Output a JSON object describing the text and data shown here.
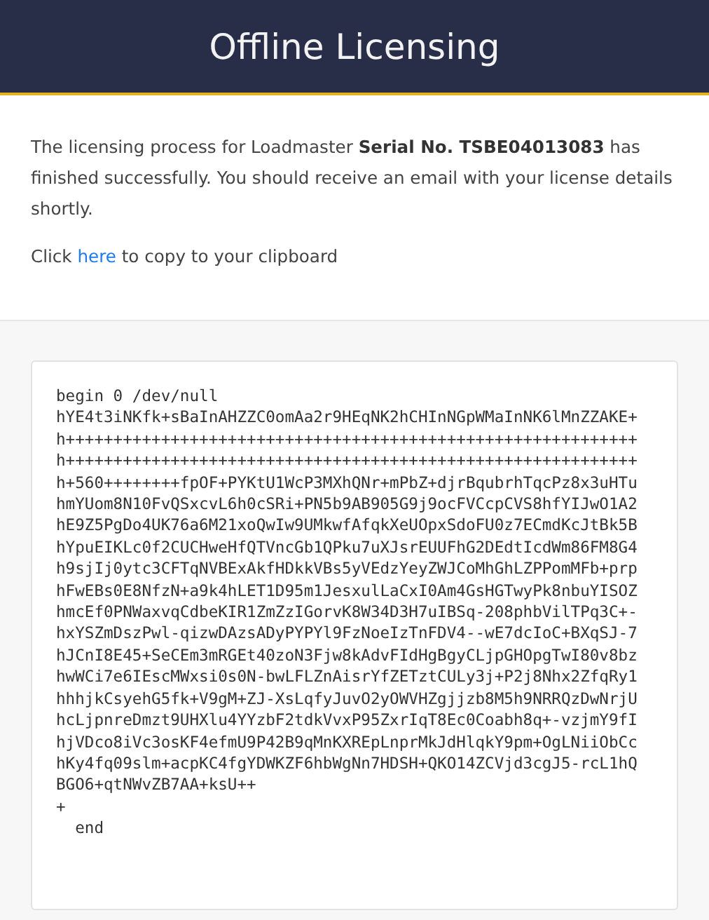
{
  "header": {
    "title": "Offline Licensing"
  },
  "message": "The licensing process for Loadmaster **Serial No. TSBE04013083** has finished successfully. You should receive an email with your license details shortly.",
  "copy_hint": {
    "before": "Click ",
    "link": "here",
    "after": " to copy to your clipboard"
  },
  "license_block": {
    "lines": [
      "begin 0 /dev/null",
      "hYE4t3iNKfk+sBaInAHZZC0omAa2r9HEqNK2hCHInNGpWMaInNK6lMnZZAKE+",
      "h++++++++++++++++++++++++++++++++++++++++++++++++++++++++++++",
      "h++++++++++++++++++++++++++++++++++++++++++++++++++++++++++++",
      "h+560++++++++fpOF+PYKtU1WcP3MXhQNr+mPbZ+djrBqubrhTqcPz8x3uHTu",
      "hmYUom8N10FvQSxcvL6h0cSRi+PN5b9AB905G9j9ocFVCcpCVS8hfYIJwO1A2",
      "hE9Z5PgDo4UK76a6M21xoQwIw9UMkwfAfqkXeUOpxSdoFU0z7ECmdKcJtBk5B",
      "hYpuEIKLc0f2CUCHweHfQTVncGb1QPku7uXJsrEUUFhG2DEdtIcdWm86FM8G4",
      "h9sjIj0ytc3CFTqNVBExAkfHDkkVBs5yVEdzYeyZWJCoMhGhLZPPomMFb+prp",
      "hFwEBs0E8NfzN+a9k4hLET1D95m1JesxulLaCxI0Am4GsHGTwyPk8nbuYISOZ",
      "hmcEf0PNWaxvqCdbeKIR1ZmZzIGorvK8W34D3H7uIBSq-208phbVilTPq3C+-",
      "hxYSZmDszPwl-qizwDAzsADyPYPYl9FzNoeIzTnFDV4--wE7dcIoC+BXqSJ-7",
      "hJCnI8E45+SeCEm3mRGEt40zoN3Fjw8kAdvFIdHgBgyCLjpGHOpgTwI80v8bz",
      "hwWCi7e6IEscMWxsi0s0N-bwLFLZnAisrYfZETztCULy3j+P2j8Nhx2ZfqRy1",
      "hhhjkCsyehG5fk+V9gM+ZJ-XsLqfyJuvO2yOWVHZgjjzb8M5h9NRRQzDwNrjU",
      "hcLjpnreDmzt9UHXlu4YYzbF2tdkVvxP95ZxrIqT8Ec0Coabh8q+-vzjmY9fI",
      "hjVDco8iVc3osKF4efmU9P42B9qMnKXREpLnprMkJdHlqkY9pm+OgLNiiObCc",
      "hKy4fq09slm+acpKC4fgYDWKZF6hbWgNn7HDSH+QKO14ZCVjd3cgJ5-rcL1hQ",
      "BGO6+qtNWvZB7AA+ksU++",
      "+",
      "  end"
    ]
  }
}
